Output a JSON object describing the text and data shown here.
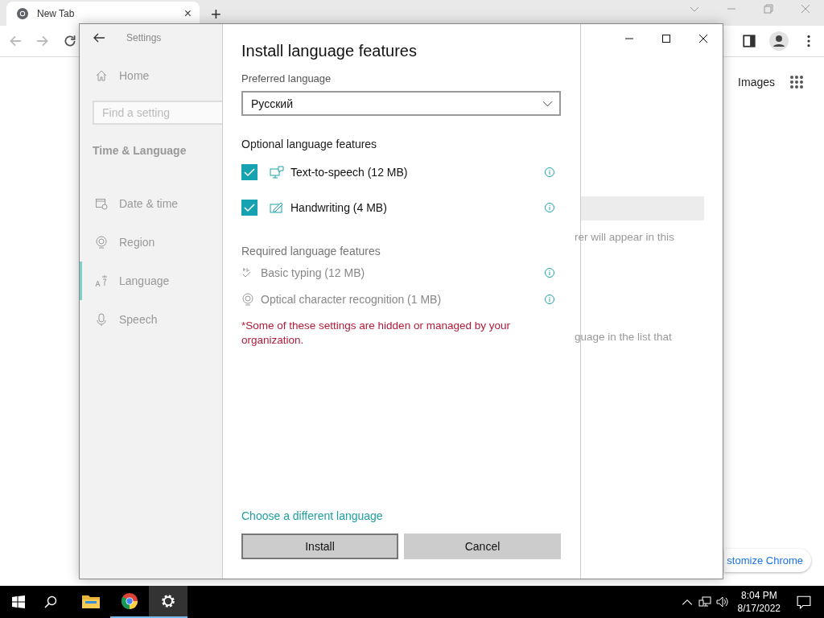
{
  "browser": {
    "tab": {
      "title": "New Tab",
      "close": "×"
    },
    "new_tab": "+",
    "links": [
      "Images"
    ],
    "customize_button": "stomize Chrome"
  },
  "settings": {
    "title": "Settings",
    "home": "Home",
    "search": {
      "placeholder": "Find a setting"
    },
    "section": "Time & Language",
    "nav": [
      {
        "kind": "date",
        "label": "Date & time",
        "selected": false
      },
      {
        "kind": "region",
        "label": "Region",
        "selected": false
      },
      {
        "kind": "language",
        "label": "Language",
        "selected": true
      },
      {
        "kind": "speech",
        "label": "Speech",
        "selected": false
      }
    ],
    "background_texts": [
      "rer will appear in this",
      "guage in the list that"
    ]
  },
  "dialog": {
    "title": "Install language features",
    "preferred_label": "Preferred language",
    "preferred_value": "Русский",
    "optional_heading": "Optional language features",
    "optional": [
      {
        "kind": "tts",
        "label": "Text-to-speech (12 MB)",
        "checked": true
      },
      {
        "kind": "handwriting",
        "label": "Handwriting (4 MB)",
        "checked": true
      }
    ],
    "required_heading": "Required language features",
    "required": [
      {
        "kind": "typing",
        "label": "Basic typing (12 MB)"
      },
      {
        "kind": "ocr",
        "label": "Optical character recognition (1 MB)"
      }
    ],
    "note": "*Some of these settings are hidden or managed by your organization.",
    "link": "Choose a different language",
    "buttons": [
      {
        "label": "Install",
        "selected": true
      },
      {
        "label": "Cancel",
        "selected": false
      }
    ]
  },
  "taskbar": {
    "apps": [
      {
        "kind": "explorer",
        "running": false,
        "selected": false
      },
      {
        "kind": "chrome",
        "running": true,
        "selected": false
      },
      {
        "kind": "settings",
        "running": true,
        "selected": true
      }
    ],
    "time": "8:04 PM",
    "date": "8/17/2022"
  }
}
